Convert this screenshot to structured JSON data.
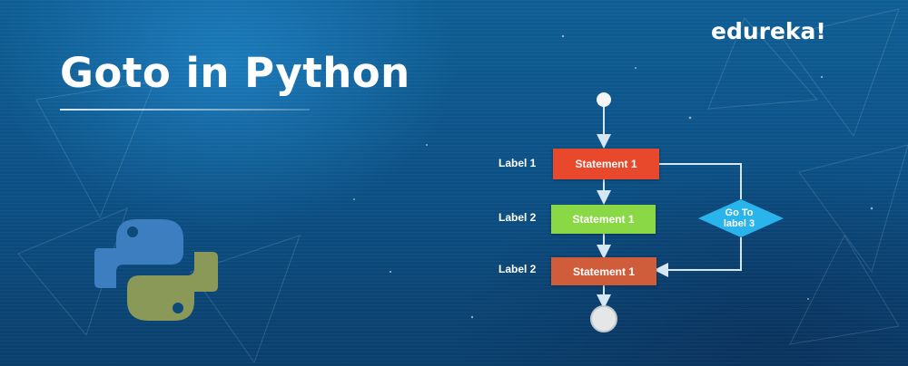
{
  "header": {
    "title": "Goto in Python",
    "brand": "edureka!"
  },
  "flowchart": {
    "nodes": [
      {
        "label": "Label 1",
        "text": "Statement 1",
        "color": "#e8482b"
      },
      {
        "label": "Label 2",
        "text": "Statement 1",
        "color": "#8ad846"
      },
      {
        "label": "Label 2",
        "text": "Statement 1",
        "color": "#cf5d3c"
      }
    ],
    "decision": {
      "line1": "Go To",
      "line2": "label 3",
      "color": "#29b4ec"
    }
  },
  "icons": {
    "python_logo": "python-logo-icon"
  },
  "colors": {
    "background": "#0d4a7a",
    "connector": "#d6e7f4",
    "logo_blue": "#3d7ec0",
    "logo_yellow": "#8a9858"
  }
}
